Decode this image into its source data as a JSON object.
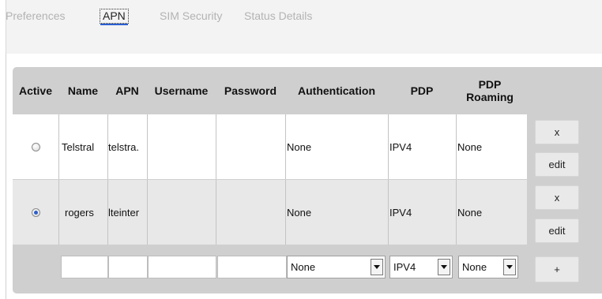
{
  "tabs": [
    {
      "label": "Preferences"
    },
    {
      "label": "APN"
    },
    {
      "label": "SIM Security"
    },
    {
      "label": "Status Details"
    }
  ],
  "table": {
    "headers": {
      "active": "Active",
      "name": "Name",
      "apn": "APN",
      "username": "Username",
      "password": "Password",
      "authentication": "Authentication",
      "pdp": "PDP",
      "pdp_roaming": "PDP Roaming"
    },
    "rows": [
      {
        "active": false,
        "name": "Telstral",
        "apn": "telstra.",
        "username": "",
        "password": "",
        "authentication": "None",
        "pdp": "IPV4",
        "pdp_roaming": "None",
        "delete_label": "x",
        "edit_label": "edit"
      },
      {
        "active": true,
        "name": "rogers",
        "apn": "lteinter",
        "username": "",
        "password": "",
        "authentication": "None",
        "pdp": "IPV4",
        "pdp_roaming": "None",
        "delete_label": "x",
        "edit_label": "edit"
      }
    ],
    "new_row": {
      "name": "",
      "apn": "",
      "username": "",
      "password": "",
      "authentication": "None",
      "pdp": "IPV4",
      "pdp_roaming": "None",
      "add_label": "+"
    }
  },
  "colors": {
    "panel": "#cfcfcf",
    "row_white": "#ffffff",
    "row_gray": "#e8e8e8",
    "tab_inactive": "#b3b3b3",
    "tab_underline": "#2a5fd0"
  }
}
